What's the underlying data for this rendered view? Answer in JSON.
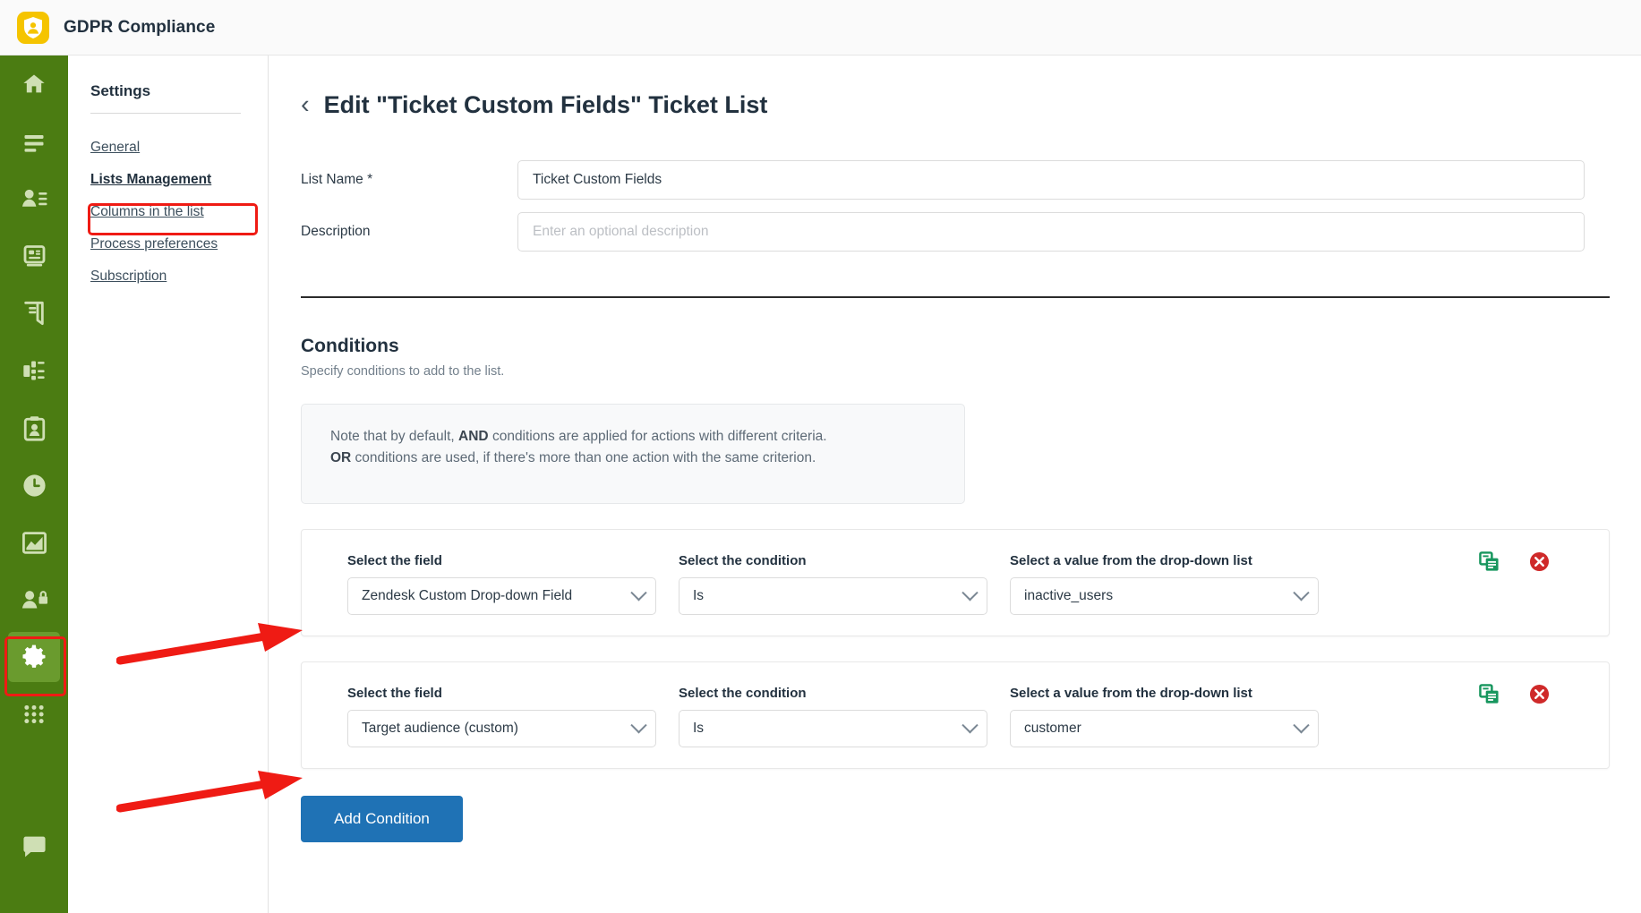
{
  "app": {
    "title": "GDPR Compliance",
    "logo_icon": "shield-person-icon",
    "logo_color": "#f5c400"
  },
  "rail": {
    "items": [
      {
        "name": "home-icon",
        "label": "Home"
      },
      {
        "name": "list-icon",
        "label": "Records"
      },
      {
        "name": "person-list-icon",
        "label": "Data subjects"
      },
      {
        "name": "database-icon",
        "label": "Data sources"
      },
      {
        "name": "book-icon",
        "label": "Register"
      },
      {
        "name": "flow-chart-icon",
        "label": "Processes"
      },
      {
        "name": "clipboard-person-icon",
        "label": "Assessments"
      },
      {
        "name": "clock-icon",
        "label": "Retention"
      },
      {
        "name": "chart-area-icon",
        "label": "Reports"
      },
      {
        "name": "person-lock-icon",
        "label": "Access"
      },
      {
        "name": "gear-icon",
        "label": "Settings",
        "active": true
      },
      {
        "name": "grid-apps-icon",
        "label": "Apps"
      },
      {
        "name": "chat-icon",
        "label": "Support"
      }
    ]
  },
  "settings": {
    "title": "Settings",
    "links": [
      {
        "label": "General",
        "current": false
      },
      {
        "label": "Lists Management",
        "current": true
      },
      {
        "label": "Columns in the list",
        "current": false
      },
      {
        "label": "Process preferences",
        "current": false
      },
      {
        "label": "Subscription",
        "current": false
      }
    ]
  },
  "page": {
    "back_icon": "chevron-left-icon",
    "back_glyph": "‹",
    "title": "Edit \"Ticket Custom Fields\" Ticket List"
  },
  "form": {
    "list_name_label": "List Name *",
    "list_name_value": "Ticket Custom Fields",
    "description_label": "Description",
    "description_value": "",
    "description_placeholder": "Enter an optional description"
  },
  "conditions": {
    "heading": "Conditions",
    "subheading": "Specify conditions to add to the list.",
    "note": {
      "line1_pre": "Note that by default, ",
      "line1_bold": "AND",
      "line1_post": " conditions are applied for actions with different criteria.",
      "line2_bold": "OR",
      "line2_post": " conditions are used, if there's more than one action with the same criterion."
    },
    "col_labels": {
      "field": "Select the field",
      "condition": "Select the condition",
      "value": "Select a value from the drop-down list"
    },
    "rows": [
      {
        "field": "Zendesk Custom Drop-down Field",
        "condition": "Is",
        "value": "inactive_users",
        "copy_icon": "copy-icon",
        "delete_icon": "delete-circle-icon"
      },
      {
        "field": "Target audience (custom)",
        "condition": "Is",
        "value": "customer",
        "copy_icon": "copy-icon",
        "delete_icon": "delete-circle-icon"
      }
    ],
    "add_button": "Add Condition"
  },
  "colors": {
    "rail_green": "#4b7c12",
    "rail_active": "#6a9b2e",
    "annotation_red": "#ef1b14",
    "primary_blue": "#1f72b5",
    "copy_green": "#17965e",
    "delete_red": "#cf2a2a",
    "brand_yellow": "#f5c400"
  }
}
